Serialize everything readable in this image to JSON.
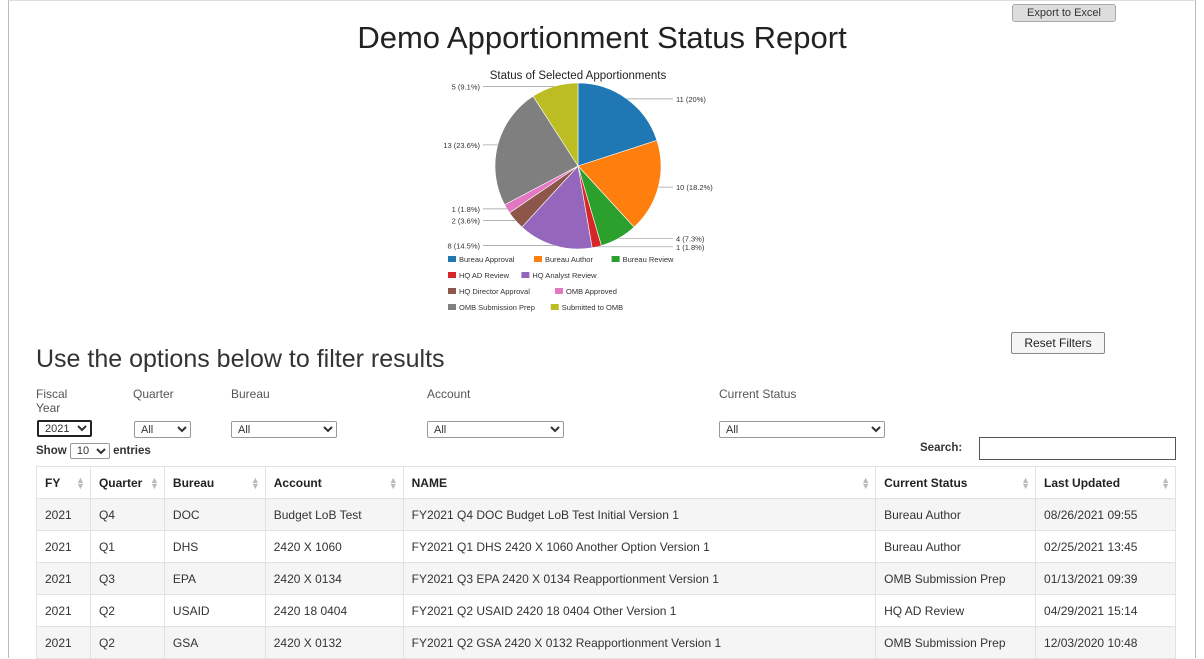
{
  "header": {
    "title": "Demo Apportionment Status Report",
    "export_label": "Export to Excel"
  },
  "chart_data": {
    "type": "pie",
    "title": "Status of Selected Apportionments",
    "slices": [
      {
        "label": "Bureau Approval",
        "value": 11,
        "text": "11 (20%)",
        "color": "#1f77b4"
      },
      {
        "label": "Bureau Author",
        "value": 10,
        "text": "10 (18.2%)",
        "color": "#ff7f0e"
      },
      {
        "label": "Bureau Review",
        "value": 4,
        "text": "4 (7.3%)",
        "color": "#2ca02c"
      },
      {
        "label": "HQ AD Review",
        "value": 1,
        "text": "1 (1.8%)",
        "color": "#d62728"
      },
      {
        "label": "HQ Analyst Review",
        "value": 8,
        "text": "8 (14.5%)",
        "color": "#9467bd"
      },
      {
        "label": "HQ Director Approval",
        "value": 2,
        "text": "2 (3.6%)",
        "color": "#8c564b"
      },
      {
        "label": "OMB Approved",
        "value": 1,
        "text": "1 (1.8%)",
        "color": "#e377c2"
      },
      {
        "label": "OMB Submission Prep",
        "value": 13,
        "text": "13 (23.6%)",
        "color": "#7f7f7f"
      },
      {
        "label": "Submitted to OMB",
        "value": 5,
        "text": "5 (9.1%)",
        "color": "#bcbd22"
      }
    ],
    "legend_placement": "bottom"
  },
  "filters": {
    "heading": "Use the options below to filter results",
    "reset_label": "Reset Filters",
    "fiscal_year": {
      "label": "Fiscal Year",
      "value": "2021"
    },
    "quarter": {
      "label": "Quarter",
      "value": "All"
    },
    "bureau": {
      "label": "Bureau",
      "value": "All"
    },
    "account": {
      "label": "Account",
      "value": "All"
    },
    "current_status": {
      "label": "Current Status",
      "value": "All"
    }
  },
  "table_controls": {
    "show_label": "Show",
    "entries_value": "10",
    "entries_label": "entries",
    "search_label": "Search:",
    "search_value": ""
  },
  "table": {
    "columns": [
      "FY",
      "Quarter",
      "Bureau",
      "Account",
      "NAME",
      "Current Status",
      "Last Updated"
    ],
    "rows": [
      [
        "2021",
        "Q4",
        "DOC",
        "Budget LoB Test",
        "FY2021 Q4 DOC Budget LoB Test Initial Version 1",
        "Bureau Author",
        "08/26/2021 09:55"
      ],
      [
        "2021",
        "Q1",
        "DHS",
        "2420 X 1060",
        "FY2021 Q1 DHS 2420 X 1060 Another Option Version 1",
        "Bureau Author",
        "02/25/2021 13:45"
      ],
      [
        "2021",
        "Q3",
        "EPA",
        "2420 X 0134",
        "FY2021 Q3 EPA 2420 X 0134 Reapportionment Version 1",
        "OMB Submission Prep",
        "01/13/2021 09:39"
      ],
      [
        "2021",
        "Q2",
        "USAID",
        "2420 18 0404",
        "FY2021 Q2 USAID 2420 18 0404 Other Version 1",
        "HQ AD Review",
        "04/29/2021 15:14"
      ],
      [
        "2021",
        "Q2",
        "GSA",
        "2420 X 0132",
        "FY2021 Q2 GSA 2420 X 0132 Reapportionment Version 1",
        "OMB Submission Prep",
        "12/03/2020 10:48"
      ]
    ]
  }
}
